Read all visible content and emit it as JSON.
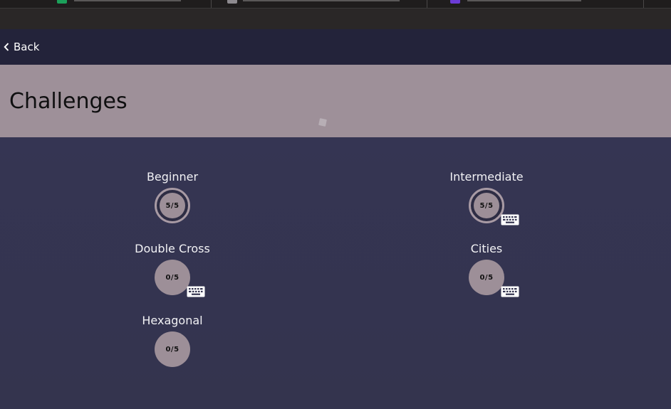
{
  "colors": {
    "background": "#34344f",
    "navbar": "#23233a",
    "header": "#9e9099",
    "badge": "#9d8f98",
    "text": "#ffffff"
  },
  "nav": {
    "back_label": "Back",
    "back_icon": "chevron-left-icon"
  },
  "header": {
    "title": "Challenges"
  },
  "challenges": [
    {
      "name": "Beginner",
      "progress": "5/5",
      "completed": true,
      "keyboard_icon": false
    },
    {
      "name": "Intermediate",
      "progress": "5/5",
      "completed": true,
      "keyboard_icon": true
    },
    {
      "name": "Double Cross",
      "progress": "0/5",
      "completed": false,
      "keyboard_icon": true
    },
    {
      "name": "Cities",
      "progress": "0/5",
      "completed": false,
      "keyboard_icon": true
    },
    {
      "name": "Hexagonal",
      "progress": "0/5",
      "completed": false,
      "keyboard_icon": false
    }
  ]
}
